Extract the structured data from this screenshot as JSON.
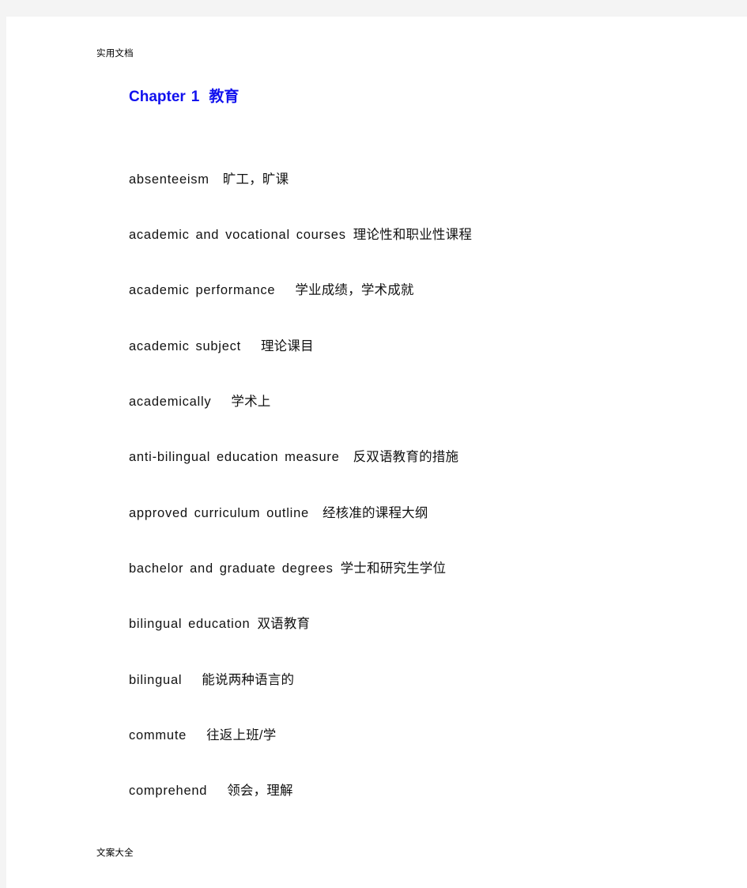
{
  "page": {
    "header_text": "实用文档",
    "footer_text": "文案大全",
    "background_color": "#f4f4f4",
    "sheet_color": "#ffffff",
    "heading_color": "#1111ee",
    "text_color": "#121212"
  },
  "chapter": {
    "label": "Chapter",
    "number": "1",
    "title": "教育"
  },
  "entries": [
    {
      "term": "absenteeism",
      "gloss": "旷工，旷课",
      "gap": "gap-md"
    },
    {
      "term": "academic and vocational courses",
      "gloss": "理论性和职业性课程",
      "gap": "gap-sm"
    },
    {
      "term": "academic performance",
      "gloss": "学业成绩，学术成就",
      "gap": "gap-lg"
    },
    {
      "term": "academic subject",
      "gloss": "理论课目",
      "gap": "gap-lg"
    },
    {
      "term": "academically",
      "gloss": "学术上",
      "gap": "gap-lg"
    },
    {
      "term": "anti-bilingual education measure",
      "gloss": "反双语教育的措施",
      "gap": "gap-md"
    },
    {
      "term": "approved curriculum outline",
      "gloss": "经核准的课程大纲",
      "gap": "gap-md"
    },
    {
      "term": "bachelor and graduate degrees",
      "gloss": "学士和研究生学位",
      "gap": "gap-sm"
    },
    {
      "term": "bilingual education",
      "gloss": "双语教育",
      "gap": "gap-sm"
    },
    {
      "term": "bilingual",
      "gloss": "能说两种语言的",
      "gap": "gap-lg"
    },
    {
      "term": "commute",
      "gloss": "往返上班/学",
      "gap": "gap-lg"
    },
    {
      "term": "comprehend",
      "gloss": "领会，理解",
      "gap": "gap-lg"
    }
  ]
}
